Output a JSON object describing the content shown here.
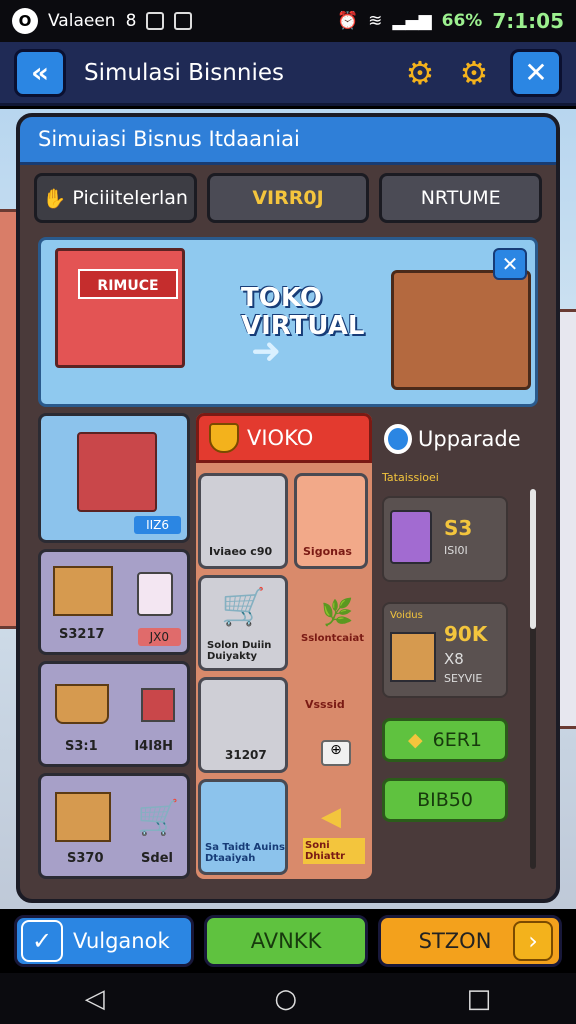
{
  "status": {
    "app": "Valaeen",
    "battery": "66%",
    "time": "7:1:05"
  },
  "header": {
    "title": "Simulasi Bisnnies"
  },
  "panel": {
    "title": "Simuiasi Bisnus Itdaaniai",
    "tabs": [
      "Piciiitelerlan",
      "VIRR0J",
      "NRTUME"
    ]
  },
  "banner": {
    "line1": "TOKO",
    "line2": "VIRTUAL",
    "shop_sign": "RIMUCE"
  },
  "colA": [
    {
      "label": "IIZ6",
      "price": ""
    },
    {
      "label": "S3217",
      "price": "JX0"
    },
    {
      "label": "S3:1",
      "price": "I4I8H"
    },
    {
      "label": "S370",
      "price": "Sdel"
    }
  ],
  "colB": {
    "header": "VIOKO",
    "cells": [
      {
        "label": "Iviaeo c90"
      },
      {
        "label": "Sigonas"
      },
      {
        "label": "Solon Duiin Duiyakty"
      },
      {
        "label": "Sslontcaiat"
      },
      {
        "label": "31207"
      },
      {
        "label": "Vsssid"
      },
      {
        "label": "Sa Taidt Auins Dtaaiyah"
      },
      {
        "label": "Soni Dhiattr"
      }
    ]
  },
  "upgrade": {
    "title": "Upparade",
    "subtitle": "Tataissioei",
    "cards": [
      {
        "value": "S3",
        "sub": "ISI0I"
      },
      {
        "value": "90K",
        "label": "Voidus",
        "value2": "X8",
        "sub": "SEYVIE"
      }
    ],
    "buttons": [
      "6ER1",
      "BIB50"
    ]
  },
  "bottom": [
    "Vulganok",
    "AVNKK",
    "STZON"
  ],
  "colors": {
    "accent": "#2b86e3",
    "green": "#5fc23f",
    "orange": "#f3a11c",
    "red": "#e33a2f"
  }
}
